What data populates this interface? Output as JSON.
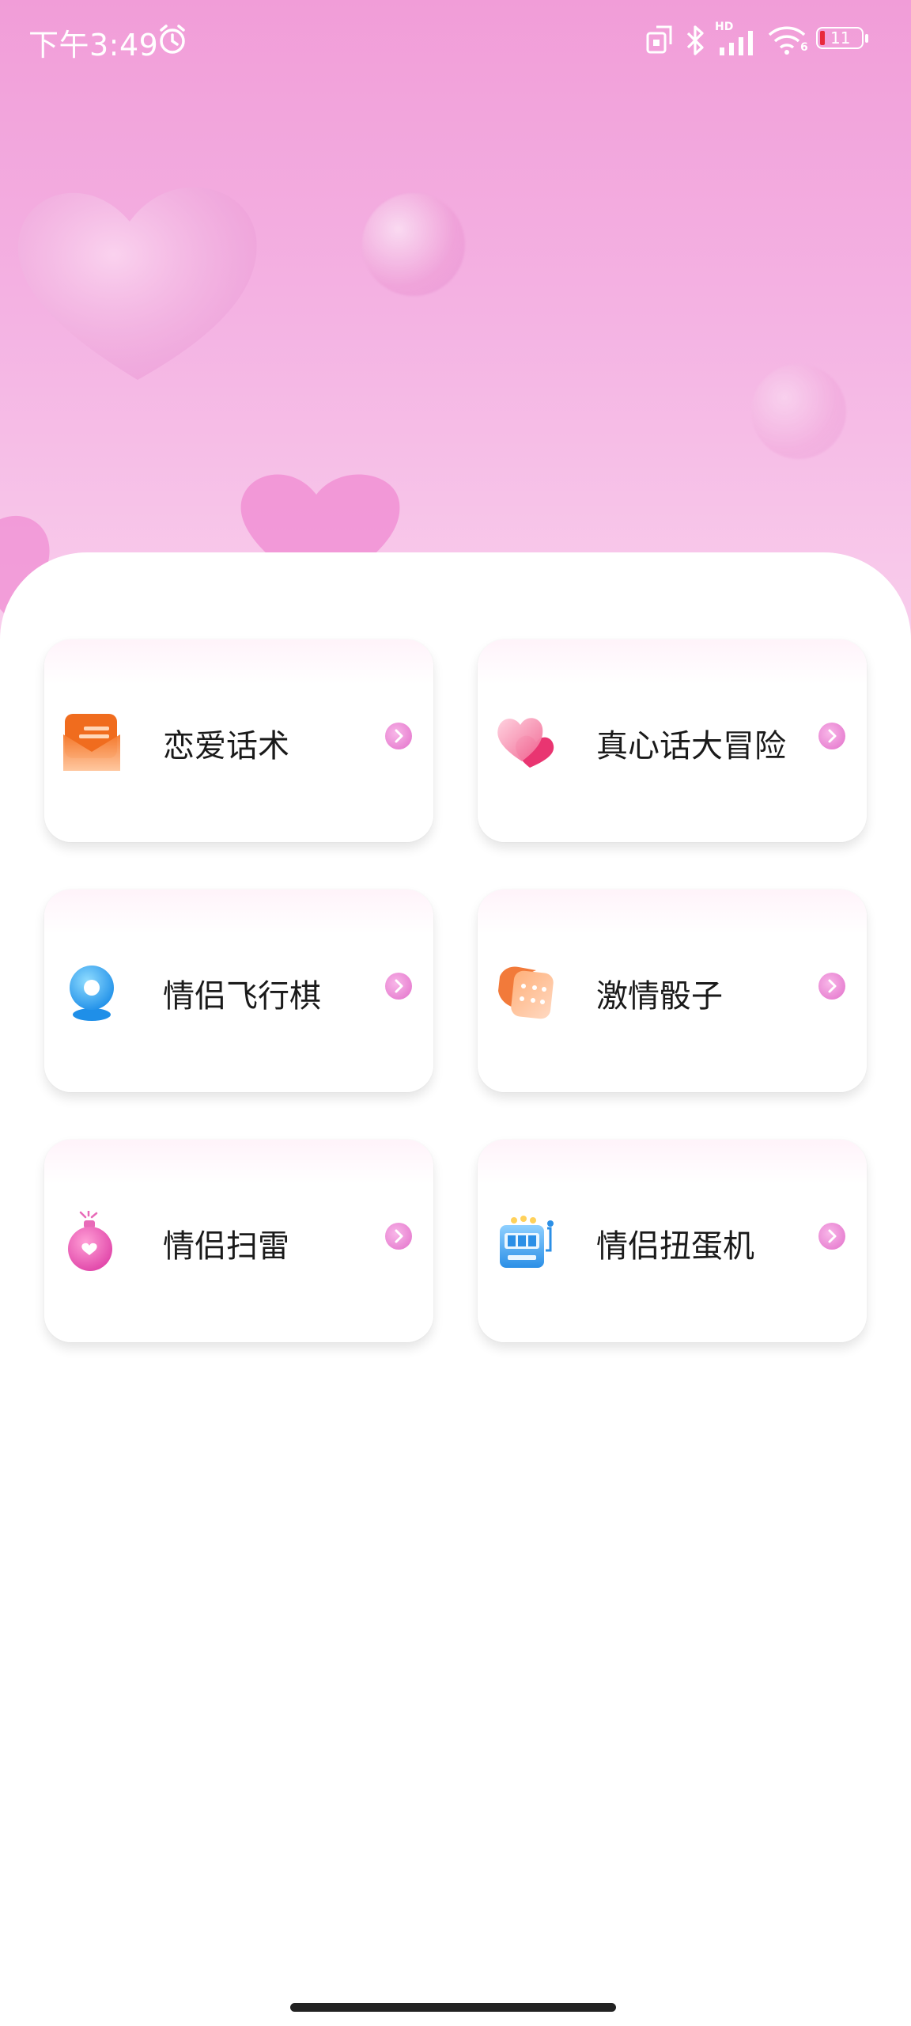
{
  "status_bar": {
    "time": "下午3:49",
    "battery": "11",
    "network_label": "HD",
    "wifi_label": "6"
  },
  "cards": [
    {
      "label": "恋爱话术",
      "icon": "envelope-icon"
    },
    {
      "label": "真心话大冒险",
      "icon": "heart-icon"
    },
    {
      "label": "情侣飞行棋",
      "icon": "game-disc-icon"
    },
    {
      "label": "激情骰子",
      "icon": "dice-icon"
    },
    {
      "label": "情侣扫雷",
      "icon": "bomb-icon"
    },
    {
      "label": "情侣扭蛋机",
      "icon": "slot-machine-icon"
    }
  ],
  "colors": {
    "hero_top": "#f19dd8",
    "hero_bottom": "#f9d2ee",
    "arrow_accent": "#ea8fd6"
  }
}
